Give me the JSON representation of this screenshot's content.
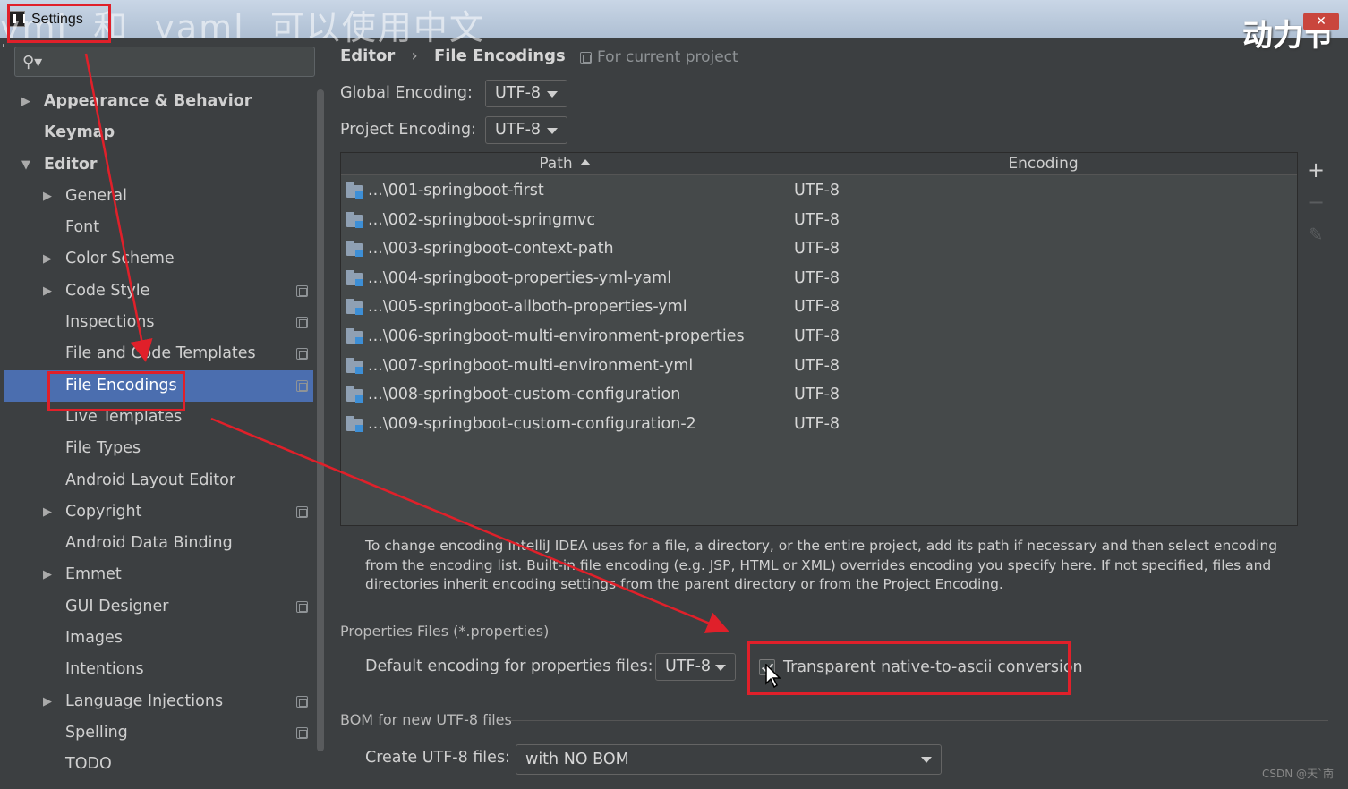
{
  "window": {
    "title": "Settings",
    "overlay_caption": "yml  和  yaml  可以使用中文",
    "brand_caption": "动力节"
  },
  "sidebar": {
    "search_placeholder": "",
    "items": [
      {
        "label": "Appearance & Behavior",
        "level": 0,
        "arrow": "right",
        "bold": true
      },
      {
        "label": "Keymap",
        "level": 0,
        "arrow": "",
        "bold": true
      },
      {
        "label": "Editor",
        "level": 0,
        "arrow": "down",
        "bold": true
      },
      {
        "label": "General",
        "level": 1,
        "arrow": "right"
      },
      {
        "label": "Font",
        "level": 1,
        "arrow": ""
      },
      {
        "label": "Color Scheme",
        "level": 1,
        "arrow": "right"
      },
      {
        "label": "Code Style",
        "level": 1,
        "arrow": "right",
        "project_icon": true
      },
      {
        "label": "Inspections",
        "level": 1,
        "arrow": "",
        "project_icon": true
      },
      {
        "label": "File and Code Templates",
        "level": 1,
        "arrow": "",
        "project_icon": true
      },
      {
        "label": "File Encodings",
        "level": 1,
        "arrow": "",
        "project_icon": true,
        "selected": true
      },
      {
        "label": "Live Templates",
        "level": 1,
        "arrow": ""
      },
      {
        "label": "File Types",
        "level": 1,
        "arrow": ""
      },
      {
        "label": "Android Layout Editor",
        "level": 1,
        "arrow": ""
      },
      {
        "label": "Copyright",
        "level": 1,
        "arrow": "right",
        "project_icon": true
      },
      {
        "label": "Android Data Binding",
        "level": 1,
        "arrow": ""
      },
      {
        "label": "Emmet",
        "level": 1,
        "arrow": "right"
      },
      {
        "label": "GUI Designer",
        "level": 1,
        "arrow": "",
        "project_icon": true
      },
      {
        "label": "Images",
        "level": 1,
        "arrow": ""
      },
      {
        "label": "Intentions",
        "level": 1,
        "arrow": ""
      },
      {
        "label": "Language Injections",
        "level": 1,
        "arrow": "right",
        "project_icon": true
      },
      {
        "label": "Spelling",
        "level": 1,
        "arrow": "",
        "project_icon": true
      },
      {
        "label": "TODO",
        "level": 1,
        "arrow": ""
      }
    ]
  },
  "main": {
    "breadcrumb": [
      "Editor",
      "File Encodings"
    ],
    "breadcrumb_sep": "›",
    "for_current_project": "For current project",
    "global_encoding_label": "Global Encoding:",
    "global_encoding_value": "UTF-8",
    "project_encoding_label": "Project Encoding:",
    "project_encoding_value": "UTF-8",
    "table": {
      "columns": [
        "Path",
        "Encoding"
      ],
      "rows": [
        {
          "path": "...\\001-springboot-first",
          "encoding": "UTF-8"
        },
        {
          "path": "...\\002-springboot-springmvc",
          "encoding": "UTF-8"
        },
        {
          "path": "...\\003-springboot-context-path",
          "encoding": "UTF-8"
        },
        {
          "path": "...\\004-springboot-properties-yml-yaml",
          "encoding": "UTF-8"
        },
        {
          "path": "...\\005-springboot-allboth-properties-yml",
          "encoding": "UTF-8"
        },
        {
          "path": "...\\006-springboot-multi-environment-properties",
          "encoding": "UTF-8"
        },
        {
          "path": "...\\007-springboot-multi-environment-yml",
          "encoding": "UTF-8"
        },
        {
          "path": "...\\008-springboot-custom-configuration",
          "encoding": "UTF-8"
        },
        {
          "path": "...\\009-springboot-custom-configuration-2",
          "encoding": "UTF-8"
        }
      ],
      "tools": {
        "add": "+",
        "remove": "−",
        "edit": "✎"
      }
    },
    "description": "To change encoding IntelliJ IDEA uses for a file, a directory, or the entire project, add its path if necessary and then select encoding from the encoding list. Built-in file encoding (e.g. JSP, HTML or XML) overrides encoding you specify here. If not specified, files and directories inherit encoding settings from the parent directory or from the Project Encoding.",
    "properties_section": "Properties Files (*.properties)",
    "default_props_label": "Default encoding for properties files:",
    "default_props_value": "UTF-8",
    "transparent_label": "Transparent native-to-ascii conversion",
    "transparent_checked": true,
    "bom_section": "BOM for new UTF-8 files",
    "create_utf8_label": "Create UTF-8 files:",
    "create_utf8_value": "with NO BOM"
  },
  "watermark": "CSDN @天`南",
  "colors": {
    "background": "#3c3f41",
    "selection": "#4b6eaf",
    "annotation_red": "#e0202a"
  }
}
